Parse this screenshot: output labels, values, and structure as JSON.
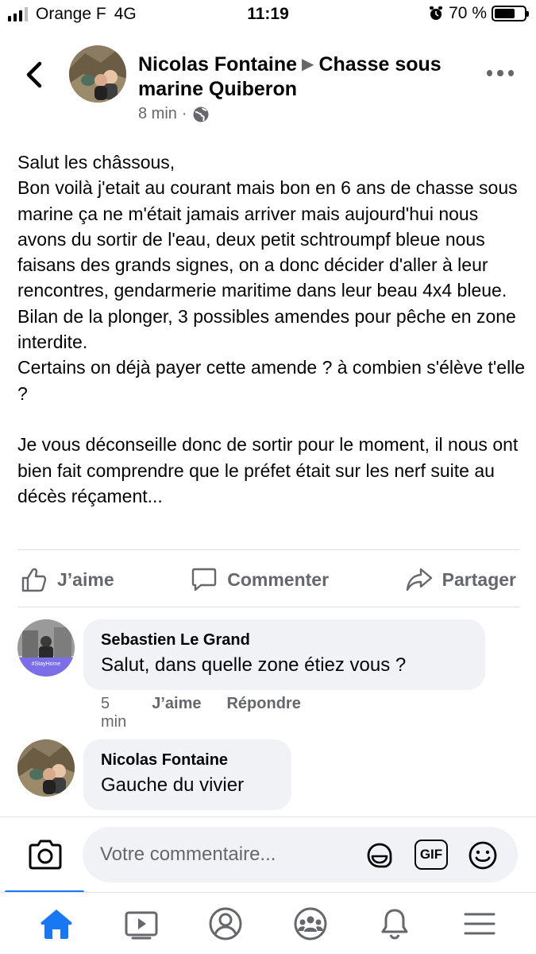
{
  "status_bar": {
    "carrier": "Orange F",
    "network": "4G",
    "time": "11:19",
    "battery_text": "70 %",
    "battery_level": 0.7
  },
  "post": {
    "author": "Nicolas Fontaine",
    "group": "Chasse sous marine Quiberon",
    "time": "8 min",
    "separator": "·",
    "body": "Salut les châssous,\nBon voilà j'etait au courant mais bon en 6 ans de chasse sous marine ça ne m'était jamais arriver mais aujourd'hui nous avons du sortir de l'eau, deux petit schtroumpf bleue nous faisans des grands signes, on a donc décider d'aller à leur rencontres, gendarmerie maritime dans leur beau 4x4 bleue.\nBilan de la plonger, 3 possibles amendes pour pêche en zone interdite.\nCertains on déjà payer cette amende ? à combien s'élève t'elle ?\n\nJe vous déconseille donc de sortir pour le moment, il nous ont bien fait comprendre que le préfet était sur les nerf suite au décès réçament..."
  },
  "actions": {
    "like": "J’aime",
    "comment": "Commenter",
    "share": "Partager"
  },
  "comments": [
    {
      "author": "Sebastien Le Grand",
      "text": "Salut, dans quelle zone étiez vous ?",
      "time": "5 min",
      "like": "J’aime",
      "reply": "Répondre",
      "avatar_badge": "#StayHome"
    },
    {
      "author": "Nicolas Fontaine",
      "text": "Gauche du vivier"
    }
  ],
  "composer": {
    "placeholder": "Votre commentaire...",
    "gif_label": "GIF"
  },
  "nav": {
    "items": [
      "home",
      "watch",
      "profile",
      "groups",
      "notifications",
      "menu"
    ],
    "active": "home"
  },
  "colors": {
    "accent": "#1877f2",
    "secondary_text": "#65676b",
    "bubble": "#f0f2f5"
  }
}
